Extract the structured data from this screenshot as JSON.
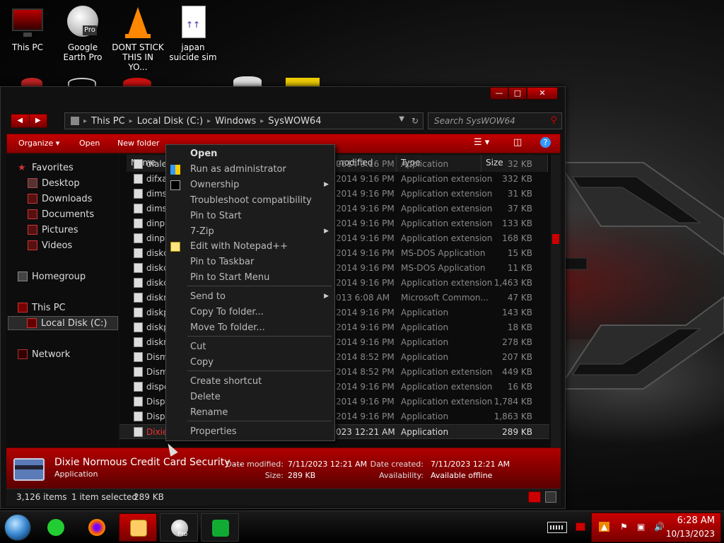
{
  "desktop": {
    "icons": [
      {
        "label": "This PC"
      },
      {
        "label": "Google Earth Pro"
      },
      {
        "label": "DONT STICK THIS IN YO..."
      },
      {
        "label": "japan suicide sim"
      }
    ],
    "google_earth_badge": "Pro"
  },
  "explorer": {
    "breadcrumb": [
      "This PC",
      "Local Disk (C:)",
      "Windows",
      "SysWOW64"
    ],
    "search_placeholder": "Search SysWOW64",
    "toolbar": {
      "organize": "Organize",
      "open": "Open",
      "new_folder": "New folder"
    },
    "nav": {
      "favorites": "Favorites",
      "desktop": "Desktop",
      "downloads": "Downloads",
      "documents": "Documents",
      "pictures": "Pictures",
      "videos": "Videos",
      "homegroup": "Homegroup",
      "this_pc": "This PC",
      "local_disk": "Local Disk (C:)",
      "network": "Network"
    },
    "columns": {
      "name": "Name",
      "date_modified": "modified",
      "type": "Type",
      "size": "Size"
    },
    "rows": [
      {
        "name": "diale",
        "date": "2014 9:16 PM",
        "type": "Application",
        "size": "32 KB"
      },
      {
        "name": "difxap",
        "date": "2014 9:16 PM",
        "type": "Application extension",
        "size": "332 KB"
      },
      {
        "name": "dimsjo",
        "date": "2014 9:16 PM",
        "type": "Application extension",
        "size": "31 KB"
      },
      {
        "name": "dimsro",
        "date": "2014 9:16 PM",
        "type": "Application extension",
        "size": "37 KB"
      },
      {
        "name": "dinpu",
        "date": "2014 9:16 PM",
        "type": "Application extension",
        "size": "133 KB"
      },
      {
        "name": "dinpu",
        "date": "2014 9:16 PM",
        "type": "Application extension",
        "size": "168 KB"
      },
      {
        "name": "diskcc",
        "date": "2014 9:16 PM",
        "type": "MS-DOS Application",
        "size": "15 KB"
      },
      {
        "name": "diskcc",
        "date": "2014 9:16 PM",
        "type": "MS-DOS Application",
        "size": "11 KB"
      },
      {
        "name": "diskcc",
        "date": "2014 9:16 PM",
        "type": "Application extension",
        "size": "1,463 KB"
      },
      {
        "name": "diskm",
        "date": "013 6:08 AM",
        "type": "Microsoft Common...",
        "size": "47 KB"
      },
      {
        "name": "diskpa",
        "date": "2014 9:16 PM",
        "type": "Application",
        "size": "143 KB"
      },
      {
        "name": "diskpe",
        "date": "2014 9:16 PM",
        "type": "Application",
        "size": "18 KB"
      },
      {
        "name": "diskra",
        "date": "2014 9:16 PM",
        "type": "Application",
        "size": "278 KB"
      },
      {
        "name": "Dism.",
        "date": "2014 8:52 PM",
        "type": "Application",
        "size": "207 KB"
      },
      {
        "name": "DismA",
        "date": "2014 8:52 PM",
        "type": "Application extension",
        "size": "449 KB"
      },
      {
        "name": "dispe",
        "date": "2014 9:16 PM",
        "type": "Application extension",
        "size": "16 KB"
      },
      {
        "name": "Displa",
        "date": "2014 9:16 PM",
        "type": "Application extension",
        "size": "1,784 KB"
      },
      {
        "name": "Displa",
        "date": "2014 9:16 PM",
        "type": "Application",
        "size": "1,863 KB"
      },
      {
        "name": "Dixie",
        "date": "023 12:21 AM",
        "type": "Application",
        "size": "289 KB"
      }
    ],
    "details": {
      "file_name": "Dixie Normous Credit Card Security ...",
      "file_type": "Application",
      "date_modified_label": "Date modified:",
      "date_modified": "7/11/2023 12:21 AM",
      "size_label": "Size:",
      "size": "289 KB",
      "date_created_label": "Date created:",
      "date_created": "7/11/2023 12:21 AM",
      "availability_label": "Availability:",
      "availability": "Available offline"
    },
    "status": {
      "items": "3,126 items",
      "selected": "1 item selected",
      "selected_size": "289 KB"
    }
  },
  "context_menu": {
    "items": [
      {
        "label": "Open"
      },
      {
        "label": "Run as administrator"
      },
      {
        "label": "Ownership"
      },
      {
        "label": "Troubleshoot compatibility"
      },
      {
        "label": "Pin to Start"
      },
      {
        "label": "7-Zip"
      },
      {
        "label": "Edit with Notepad++"
      },
      {
        "label": "Pin to Taskbar"
      },
      {
        "label": "Pin to Start Menu"
      },
      {
        "label": "Send to"
      },
      {
        "label": "Copy To folder..."
      },
      {
        "label": "Move To folder..."
      },
      {
        "label": "Cut"
      },
      {
        "label": "Copy"
      },
      {
        "label": "Create shortcut"
      },
      {
        "label": "Delete"
      },
      {
        "label": "Rename"
      },
      {
        "label": "Properties"
      }
    ]
  },
  "taskbar": {
    "time": "6:28 AM",
    "date": "10/13/2023",
    "google_earth_badge": "Pro"
  },
  "colors": {
    "accent": "#c00000",
    "dark": "#111111"
  }
}
